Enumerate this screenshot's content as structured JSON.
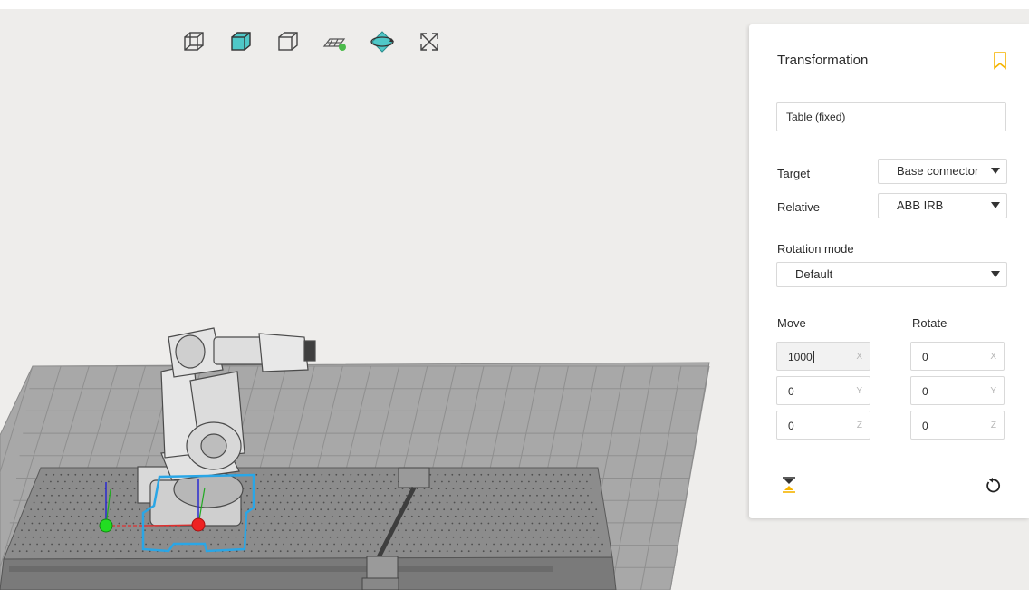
{
  "toolbar": {
    "buttons": [
      {
        "icon": "wireframe-cube-icon"
      },
      {
        "icon": "solid-cube-icon"
      },
      {
        "icon": "transparent-cube-icon"
      },
      {
        "icon": "floor-grid-icon"
      },
      {
        "icon": "orbit-rotate-icon"
      },
      {
        "icon": "fit-view-icon"
      }
    ]
  },
  "colors": {
    "accent": "#4fc8c8",
    "bookmark": "#f5b400",
    "selection": "#2aa6e6",
    "floor": "#a6a6a6",
    "grid_line": "#8e8e8e"
  },
  "panel": {
    "title": "Transformation",
    "object_name": "Table (fixed)",
    "target_label": "Target",
    "target_value": "Base connector",
    "relative_label": "Relative",
    "relative_value": "ABB IRB",
    "rotation_mode_label": "Rotation mode",
    "rotation_mode_value": "Default",
    "move_label": "Move",
    "rotate_label": "Rotate",
    "move": [
      {
        "axis": "X",
        "value": "1000"
      },
      {
        "axis": "Y",
        "value": "0"
      },
      {
        "axis": "Z",
        "value": "0"
      }
    ],
    "rotate": [
      {
        "axis": "X",
        "value": "0"
      },
      {
        "axis": "Y",
        "value": "0"
      },
      {
        "axis": "Z",
        "value": "0"
      }
    ],
    "icons": {
      "bookmark": "bookmark-icon",
      "snap": "snap-to-floor-icon",
      "reset": "reset-icon"
    }
  }
}
